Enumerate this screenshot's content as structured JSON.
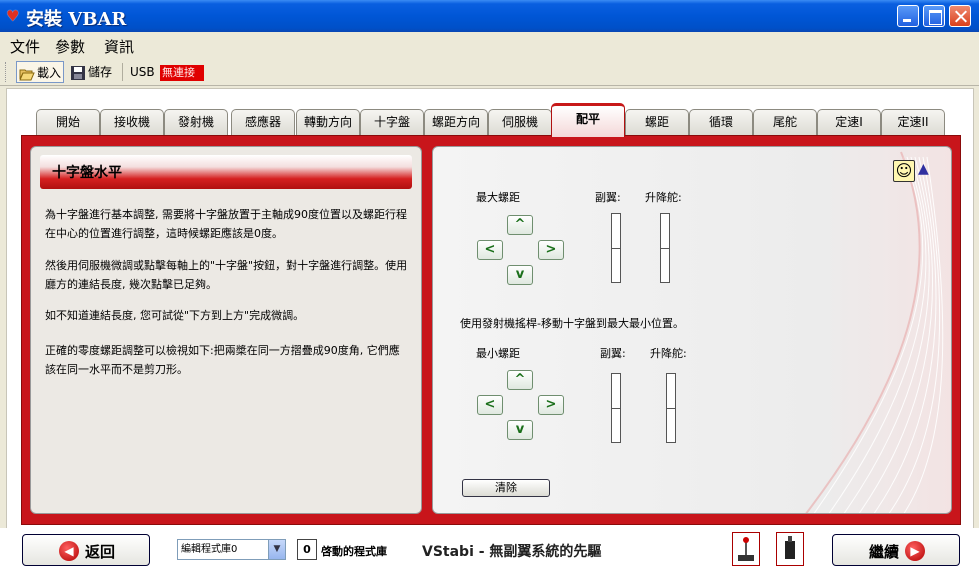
{
  "window": {
    "title": "安裝 VBAR"
  },
  "menu": [
    "文件",
    "參數",
    "資訊"
  ],
  "toolbar": {
    "open_label": "載入",
    "save_label": "儲存",
    "usb_label": "USB",
    "status": "無連接"
  },
  "tabs": [
    "開始",
    "接收機",
    "發射機",
    "感應器",
    "轉動方向",
    "十字盤",
    "螺距方向",
    "伺服機",
    "配平",
    "螺距",
    "循環",
    "尾舵",
    "定速I",
    "定速II"
  ],
  "active_tab": "配平",
  "left": {
    "heading": "十字盤水平",
    "paragraphs": [
      "為十字盤進行基本調整, 需要將十字盤放置于主軸成90度位置以及螺距行程在中心的位置進行調整，這時候螺距應該是0度。",
      "然後用伺服機微調或點擊每軸上的\"十字盤\"按鈕，對十字盤進行調整。使用廳方的連結長度, 幾次點擊已足夠。",
      "如不知道連結長度, 您可試從\"下方到上方\"完成微調。",
      "正確的零度螺距調整可以檢視如下:把兩槳在同一方摺疊成90度角, 它們應該在同一水平而不是剪刀形。"
    ]
  },
  "right": {
    "max_label": "最大螺距",
    "min_label": "最小螺距",
    "aileron_label": "副翼:",
    "elevator_label": "升降舵:",
    "instruction": "使用發射機搖桿-移動十字盤到最大最小位置。",
    "clear_label": "清除",
    "arrows": {
      "up": "^",
      "down": "v",
      "left": "<",
      "right": ">"
    }
  },
  "bottom": {
    "back_label": "返回",
    "next_label": "繼續",
    "program_bank": "編輯程式庫0",
    "active_count": "0",
    "active_label": "啓動的程式庫",
    "slogan": "VStabi - 無副翼系統的先驅"
  },
  "colors": {
    "accent": "#c8151b",
    "titlebar": "#0056d6"
  }
}
